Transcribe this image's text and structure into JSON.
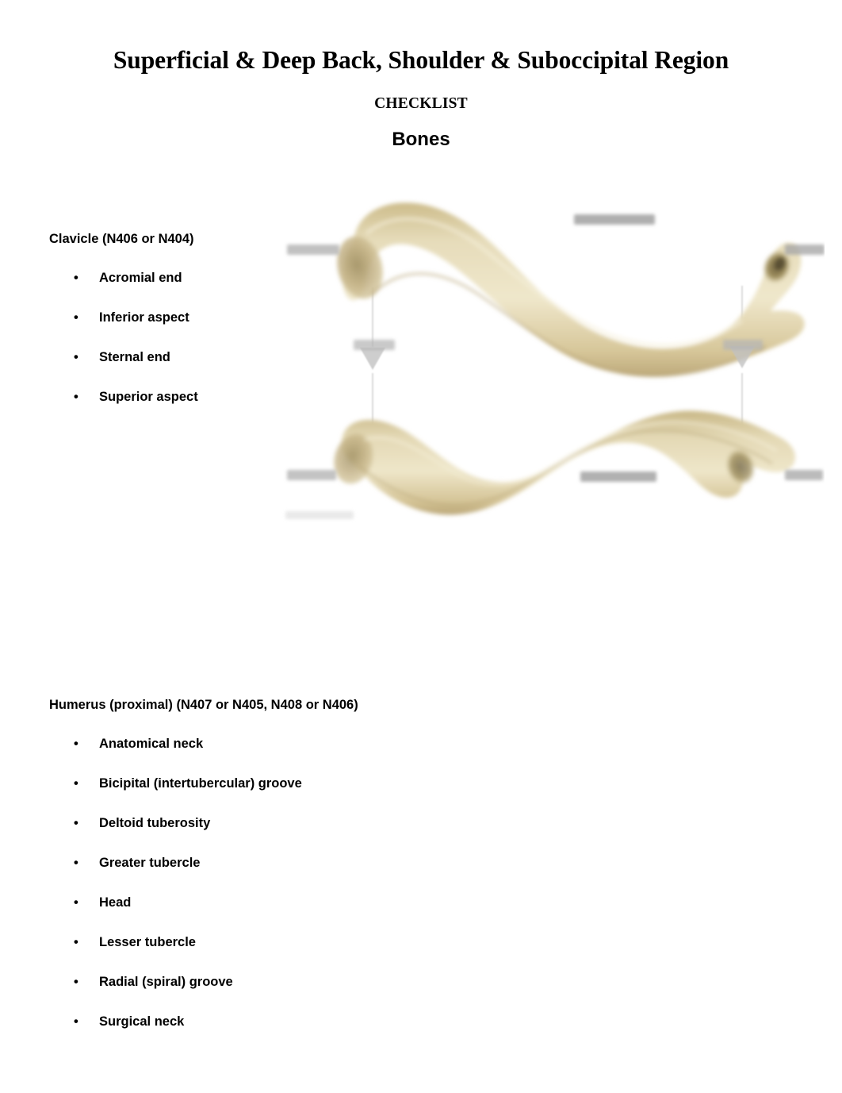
{
  "document": {
    "title": "Superficial & Deep Back, Shoulder & Suboccipital Region",
    "subtitle": "CHECKLIST",
    "section_heading": "Bones"
  },
  "sections": [
    {
      "id": "clavicle",
      "title": "Clavicle (N406 or N404)",
      "items": [
        "Acromial end",
        "Inferior aspect",
        "Sternal end",
        "Superior aspect"
      ]
    },
    {
      "id": "humerus",
      "title": "Humerus (proximal) (N407 or N405, N408 or N406)",
      "items": [
        "Anatomical neck",
        "Bicipital (intertubercular) groove",
        "Deltoid tuberosity",
        "Greater tubercle",
        "Head",
        "Lesser tubercle",
        "Radial (spiral) groove",
        "Surgical neck"
      ]
    }
  ],
  "figure": {
    "name": "clavicle-bone-illustration",
    "description": "Two clavicle bones shown in superior and inferior views with blurred illegible labels",
    "bullet_glyph": "•",
    "colors": {
      "bone_light": "#ece2c0",
      "bone_mid": "#ddcfa1",
      "bone_dark": "#c2ae78",
      "bone_shadow": "#8f7f53",
      "label_blur": "#b4b4b4",
      "leader_line": "#d8d8d8",
      "page_background": "#ffffff",
      "text": "#000000"
    }
  }
}
